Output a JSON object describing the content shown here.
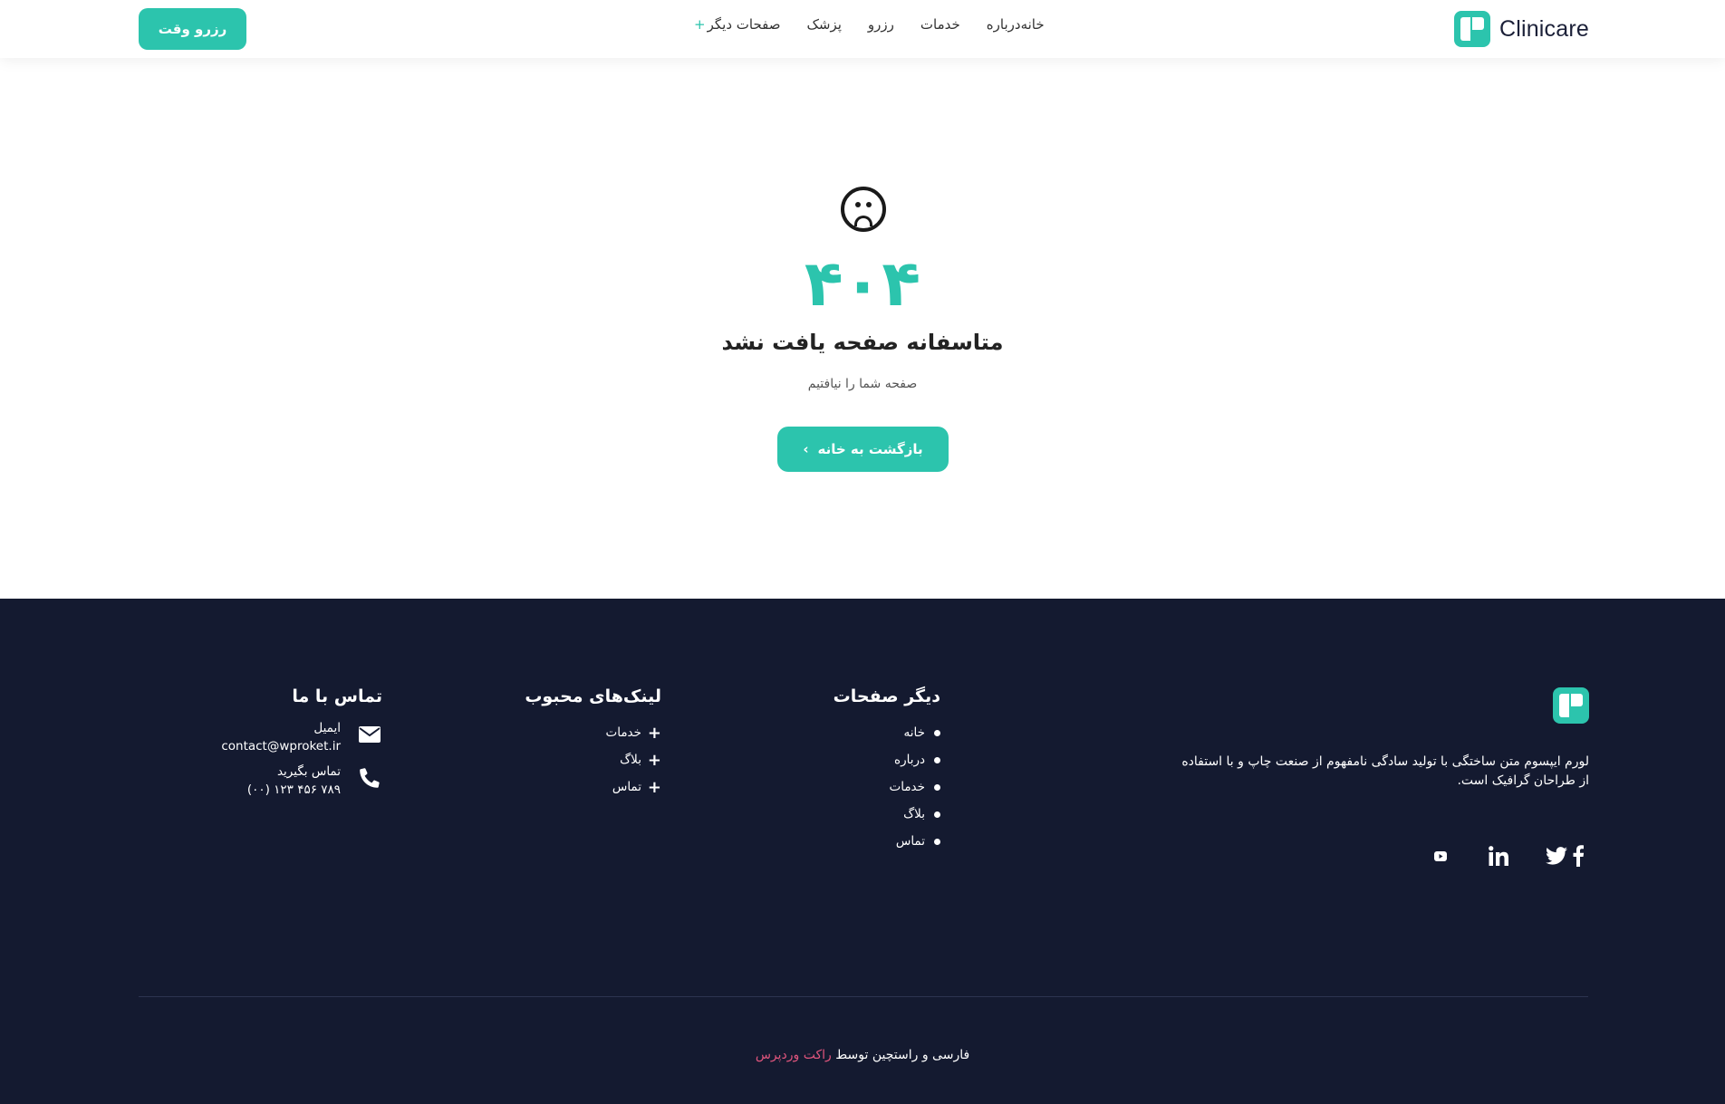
{
  "header": {
    "logo_text": "Clinicare",
    "nav": [
      {
        "label": "خانه",
        "has_plus": false
      },
      {
        "label": "درباره",
        "has_plus": false
      },
      {
        "label": "خدمات",
        "has_plus": false
      },
      {
        "label": "رزرو",
        "has_plus": false
      },
      {
        "label": "پزشک",
        "has_plus": false
      },
      {
        "label": "صفحات دیگر",
        "has_plus": true
      }
    ],
    "book_button": "رزرو وقت"
  },
  "error": {
    "icon": "sad-face-icon",
    "code": "۴۰۴",
    "title": "متاسفانه صفحه یافت نشد",
    "subtitle": "صفحه شما را نیافتیم",
    "home_button": "بازگشت به خانه",
    "home_button_icon": "chevron-left-icon"
  },
  "footer": {
    "description": "لورم ایپسوم متن ساختگی با تولید سادگی نامفهوم از صنعت چاپ و با استفاده از طراحان گرافیک است.",
    "social": [
      "facebook-icon",
      "twitter-icon",
      "linkedin-icon",
      "youtube-icon"
    ],
    "other_pages": {
      "title": "دیگر صفحات",
      "items": [
        "خانه",
        "درباره",
        "خدمات",
        "بلاگ",
        "تماس"
      ]
    },
    "popular_links": {
      "title": "لینک‌های محبوب",
      "items": [
        "خدمات",
        "بلاگ",
        "تماس"
      ]
    },
    "contact": {
      "title": "تماس با ما",
      "email_label": "ایمیل",
      "email_value": "contact@wproket.ir",
      "phone_label": "تماس بگیرید",
      "phone_value": "(۰۰) ۱۲۳ ۴۵۶ ۷۸۹"
    },
    "copyright_prefix": "فارسی و راستچین توسط",
    "copyright_brand": "راکت وردپرس"
  },
  "colors": {
    "accent": "#2cc4ad",
    "footer_bg": "#141a30",
    "brand_link": "#e0557d"
  }
}
